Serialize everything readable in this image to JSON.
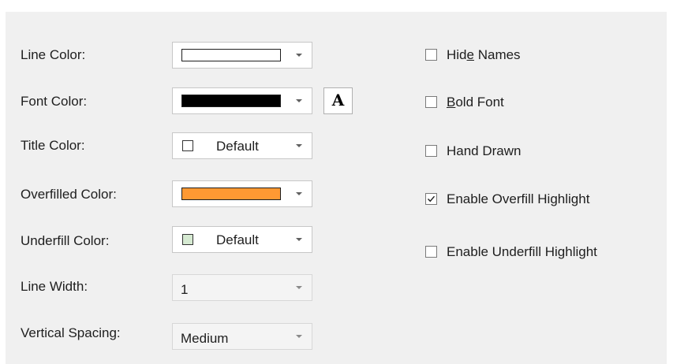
{
  "fields": {
    "line_color": {
      "label": "Line Color:"
    },
    "font_color": {
      "label": "Font Color:"
    },
    "title_color": {
      "label": "Title Color:",
      "value": "Default"
    },
    "overfilled_color": {
      "label": "Overfilled Color:"
    },
    "underfill_color": {
      "label": "Underfill Color:",
      "value": "Default"
    },
    "line_width": {
      "label": "Line Width:",
      "value": "1"
    },
    "vertical_spacing": {
      "label": "Vertical Spacing:",
      "value": "Medium"
    }
  },
  "font_button": {
    "glyph": "A"
  },
  "checkboxes": [
    {
      "label": "Hide Names",
      "mnemonic": "e",
      "checked": false
    },
    {
      "label": "Bold Font",
      "mnemonic": "B",
      "checked": false
    },
    {
      "label": "Hand Drawn",
      "checked": false
    },
    {
      "label": "Enable Overfill Highlight",
      "checked": true
    },
    {
      "label": "Enable Underfill Highlight",
      "checked": false
    }
  ],
  "colors": {
    "line_color_swatch": "#ffffff",
    "font_color_swatch": "#000000",
    "title_color_swatch": "#ffffff",
    "overfilled_color_swatch": "#ff9933",
    "underfill_color_swatch": "#d6ead2",
    "panel_background": "#f0f0f0"
  },
  "icons": {
    "dropdown": "chevron-down-icon",
    "font_button": "font-icon",
    "checkmark": "checkmark-icon"
  }
}
